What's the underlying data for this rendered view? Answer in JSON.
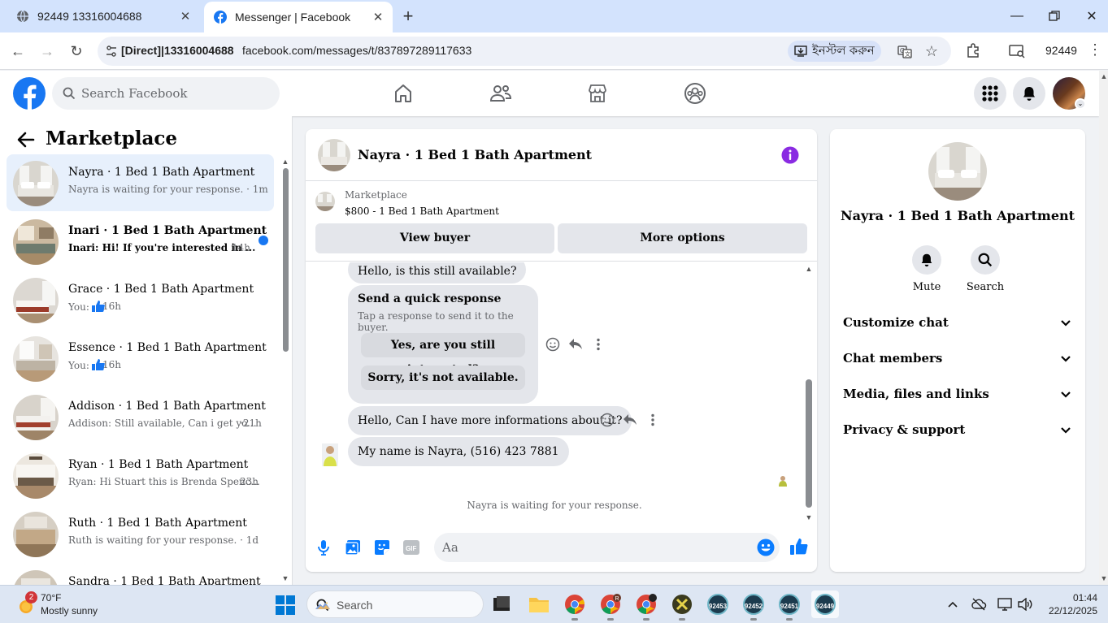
{
  "browser": {
    "tabs": [
      {
        "title": "92449 13316004688",
        "active": false
      },
      {
        "title": "Messenger | Facebook",
        "active": true
      }
    ],
    "address": {
      "prefix": "[Direct]|13316004688",
      "url": "facebook.com/messages/t/837897289117633",
      "install_label": "ইনস্টল করুন"
    },
    "profile_label": "92449"
  },
  "facebook": {
    "search_placeholder": "Search Facebook",
    "brand_color": "#1877f2"
  },
  "left": {
    "title": "Marketplace",
    "chats": [
      {
        "name": "Nayra · 1 Bed 1 Bath Apartment",
        "preview": "Nayra is waiting for your response. · 1m",
        "time": "",
        "unread": false,
        "active": true,
        "like": false
      },
      {
        "name": "Inari · 1 Bed 1 Bath Apartment",
        "preview": "Inari: Hi! If you're interested in ...",
        "time": "14h",
        "unread": true,
        "active": false,
        "like": false
      },
      {
        "name": "Grace · 1 Bed 1 Bath Apartment",
        "preview": "You:",
        "time": "16h",
        "unread": false,
        "active": false,
        "like": true
      },
      {
        "name": "Essence · 1 Bed 1 Bath Apartment",
        "preview": "You:",
        "time": "16h",
        "unread": false,
        "active": false,
        "like": true
      },
      {
        "name": "Addison · 1 Bed 1 Bath Apartment",
        "preview": "Addison: Still available, Can i get yo...",
        "time": "21h",
        "unread": false,
        "active": false,
        "like": false
      },
      {
        "name": "Ryan · 1 Bed 1 Bath Apartment",
        "preview": "Ryan: Hi Stuart this is Brenda Spenc...",
        "time": "23h",
        "unread": false,
        "active": false,
        "like": false
      },
      {
        "name": "Ruth · 1 Bed 1 Bath Apartment",
        "preview": "Ruth is waiting for your response. · 1d",
        "time": "",
        "unread": false,
        "active": false,
        "like": false
      },
      {
        "name": "Sandra · 1 Bed 1 Bath Apartment",
        "preview": "",
        "time": "",
        "unread": false,
        "active": false,
        "like": false
      }
    ]
  },
  "conversation": {
    "title": "Nayra · 1 Bed 1 Bath Apartment",
    "listing_label": "Marketplace",
    "listing_price": "$800 - 1 Bed 1 Bath Apartment",
    "view_buyer": "View buyer",
    "more_options": "More options",
    "messages": {
      "first": "Hello, is this still available?",
      "quick_title": "Send a quick response",
      "quick_sub": "Tap a response to send it to the buyer.",
      "quick_opt1": "Yes, are you still interested?",
      "quick_opt2": "Sorry, it's not available.",
      "second": "Hello, Can I have more informations about it?",
      "third": "My name is Nayra, (516) 423 7881"
    },
    "waiting": "Nayra is waiting for your response.",
    "composer_placeholder": "Aa"
  },
  "right": {
    "title": "Nayra · 1 Bed 1 Bath Apartment",
    "mute": "Mute",
    "search": "Search",
    "sections": [
      "Customize chat",
      "Chat members",
      "Media, files and links",
      "Privacy & support"
    ]
  },
  "taskbar": {
    "weather_badge": "2",
    "temp": "70°F",
    "weather": "Mostly sunny",
    "search": "Search",
    "chrome_badge": "R",
    "vm_apps": [
      "92453",
      "92452",
      "92451",
      "92449"
    ],
    "time": "01:44",
    "date": "22/12/2025"
  }
}
